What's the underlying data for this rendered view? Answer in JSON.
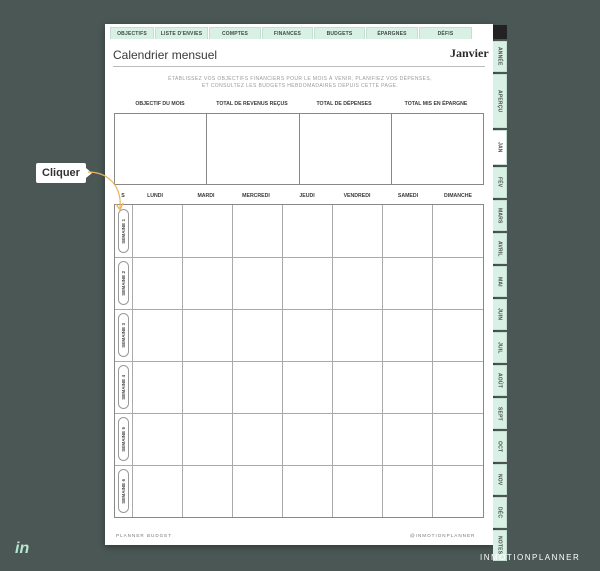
{
  "top_tabs": [
    "OBJECTIFS",
    "LISTE D'ENVIES",
    "COMPTES",
    "FINANCES",
    "BUDGETS",
    "ÉPARGNES",
    "DÉFIS"
  ],
  "side_tabs": [
    "ANNÉE",
    "APERÇU",
    "JAN",
    "FÉV",
    "MARS",
    "AVRIL",
    "MAI",
    "JUIN",
    "JUIL",
    "AOÛT",
    "SEPT",
    "OCT",
    "NOV",
    "DÉC",
    "NOTES"
  ],
  "title": "Calendrier mensuel",
  "month": "Janvier",
  "intro_line1": "ÉTABLISSEZ VOS OBJECTIFS FINANCIERS POUR LE MOIS À VENIR, PLANIFIEZ VOS DÉPENSES,",
  "intro_line2": "ET CONSULTEZ LES BUDGETS HEBDOMADAIRES DEPUIS CETTE PAGE.",
  "goal_headers": [
    "OBJECTIF DU MOIS",
    "TOTAL DE REVENUS REÇUS",
    "TOTAL DE DÉPENSES",
    "TOTAL MIS EN ÉPARGNE"
  ],
  "week_col_label": "S",
  "days": [
    "LUNDI",
    "MARDI",
    "MERCREDI",
    "JEUDI",
    "VENDREDI",
    "SAMEDI",
    "DIMANCHE"
  ],
  "weeks": [
    "SEMAINE 1",
    "SEMAINE 2",
    "SEMAINE 3",
    "SEMAINE 4",
    "SEMAINE 5",
    "SEMAINE 6"
  ],
  "footer_left": "PLANNER BUDGET",
  "footer_right": "@INMOTIONPLANNER",
  "callout": "Cliquer",
  "brand": "INMOTIONPLANNER",
  "logo": "in",
  "colors": {
    "background": "#4a5754",
    "tab": "#d9f0e5",
    "logo": "#b7e6cf"
  }
}
